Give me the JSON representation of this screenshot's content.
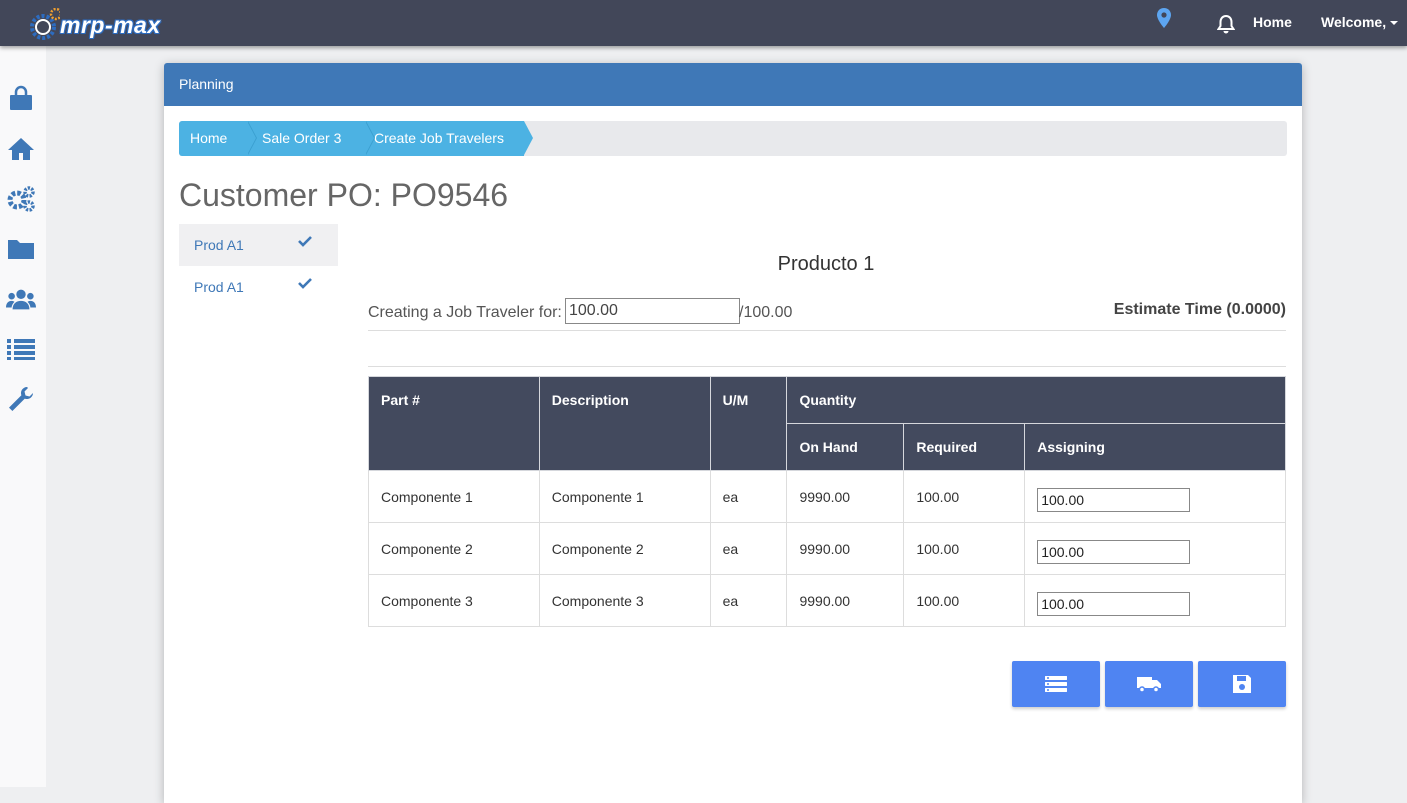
{
  "app": {
    "logo_text": "mrp-max"
  },
  "topbar": {
    "home_label": "Home",
    "welcome_label": "Welcome,"
  },
  "panel": {
    "header_title": "Planning"
  },
  "breadcrumb": [
    {
      "label": "Home"
    },
    {
      "label": "Sale Order 3"
    },
    {
      "label": "Create Job Travelers"
    }
  ],
  "page_title": "Customer PO: PO9546",
  "products": [
    {
      "label": "Prod A1",
      "checked": true,
      "active": true
    },
    {
      "label": "Prod A1",
      "checked": true,
      "active": false
    }
  ],
  "product_title": "Producto 1",
  "creating": {
    "label": "Creating a Job Traveler for:",
    "value": "100.00",
    "total": "/100.00",
    "estimate": "Estimate Time (0.0000)"
  },
  "table": {
    "headers": {
      "part": "Part #",
      "description": "Description",
      "um": "U/M",
      "quantity": "Quantity",
      "on_hand": "On Hand",
      "required": "Required",
      "assigning": "Assigning"
    },
    "rows": [
      {
        "part": "Componente 1",
        "description": "Componente 1",
        "um": "ea",
        "on_hand": "9990.00",
        "required": "100.00",
        "assigning": "100.00"
      },
      {
        "part": "Componente 2",
        "description": "Componente 2",
        "um": "ea",
        "on_hand": "9990.00",
        "required": "100.00",
        "assigning": "100.00"
      },
      {
        "part": "Componente 3",
        "description": "Componente 3",
        "um": "ea",
        "on_hand": "9990.00",
        "required": "100.00",
        "assigning": "100.00"
      }
    ]
  },
  "actions": [
    {
      "icon": "list-icon"
    },
    {
      "icon": "truck-icon"
    },
    {
      "icon": "save-icon"
    }
  ],
  "sidebar": [
    {
      "icon": "shopping-bag-icon"
    },
    {
      "icon": "home-icon"
    },
    {
      "icon": "gears-icon"
    },
    {
      "icon": "folder-icon"
    },
    {
      "icon": "users-icon"
    },
    {
      "icon": "list-icon"
    },
    {
      "icon": "wrench-icon"
    }
  ],
  "colors": {
    "topbar": "#424759",
    "panel_header": "#3f78b7",
    "breadcrumb": "#4cb2e3",
    "table_header": "#434a5e",
    "action_button": "#4f84f2"
  }
}
